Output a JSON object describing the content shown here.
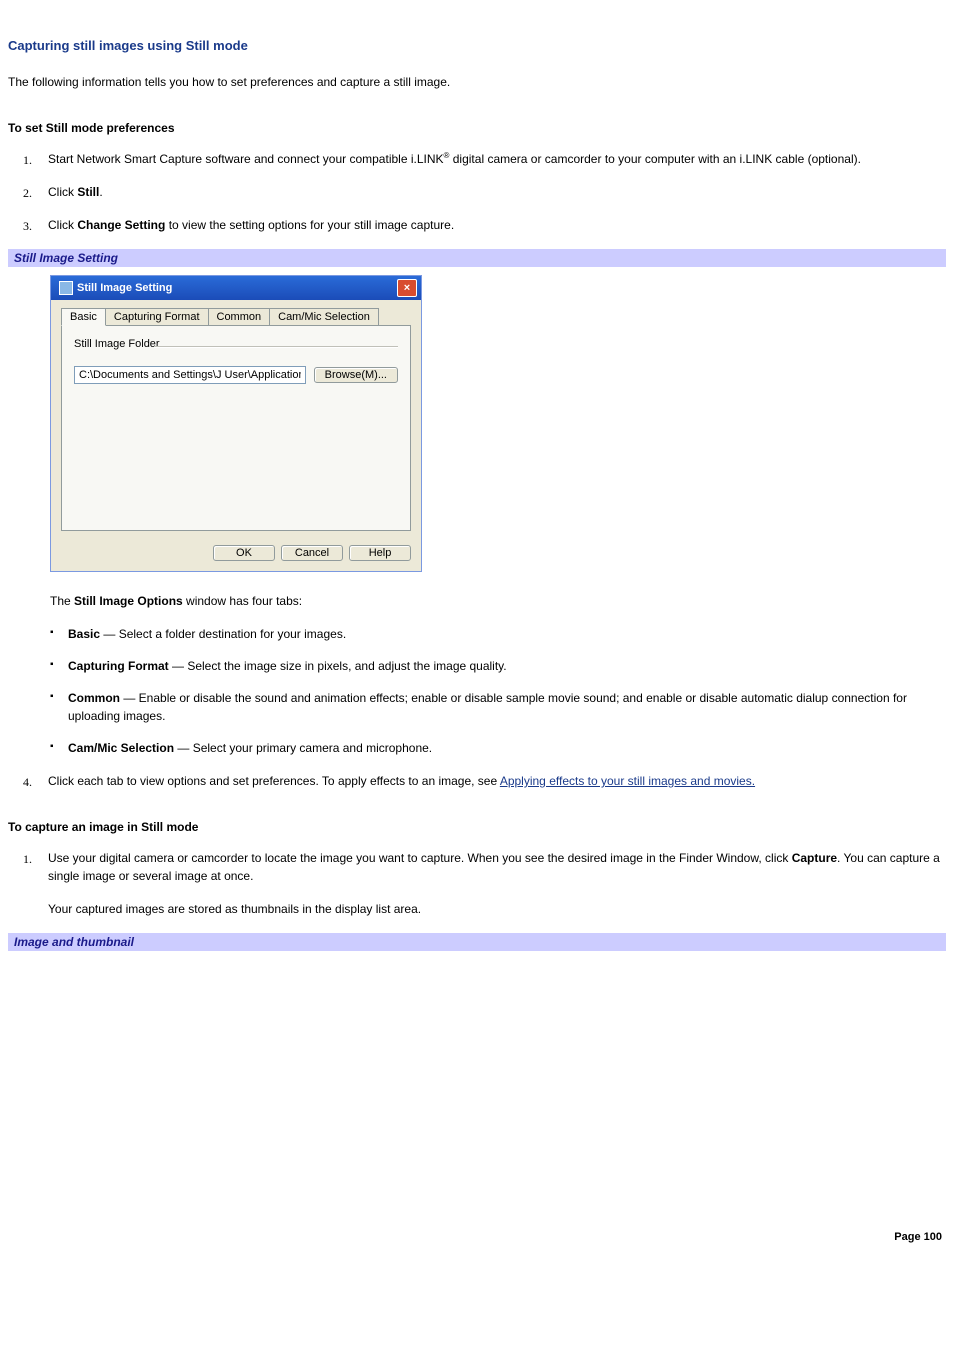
{
  "page_title": "Capturing still images using Still mode",
  "intro": "The following information tells you how to set preferences and capture a still image.",
  "section_a_heading": "To set Still mode preferences",
  "steps_a": {
    "num1": "1.",
    "s1_pre": "Start Network Smart Capture software and connect your compatible i.LINK",
    "s1_sup": "®",
    "s1_post": " digital camera or camcorder to your computer with an i.LINK cable (optional).",
    "num2": "2.",
    "s2_pre": "Click ",
    "s2_bold": "Still",
    "s2_post": ".",
    "num3": "3.",
    "s3_pre": "Click ",
    "s3_bold": "Change Setting",
    "s3_post": " to view the setting options for your still image capture."
  },
  "image_caption_1": "Still Image Setting",
  "dialog": {
    "title": "Still Image Setting",
    "tabs": {
      "basic": "Basic",
      "capturing_format": "Capturing Format",
      "common": "Common",
      "cam_mic": "Cam/Mic Selection"
    },
    "fieldset_label": "Still Image Folder",
    "path_value": "C:\\Documents and Settings\\J User\\Application Data\\So",
    "browse_label": "Browse(M)...",
    "ok": "OK",
    "cancel": "Cancel",
    "help": "Help"
  },
  "sub_intro_pre": "The ",
  "sub_intro_bold": "Still Image Options",
  "sub_intro_post": " window has four tabs:",
  "bullets": {
    "b1_bold": "Basic",
    "b1_rest": " — Select a folder destination for your images.",
    "b2_bold": "Capturing Format",
    "b2_rest": " — Select the image size in pixels, and adjust the image quality.",
    "b3_bold": "Common",
    "b3_rest": " — Enable or disable the sound and animation effects; enable or disable sample movie sound; and enable or disable automatic dialup connection for uploading images.",
    "b4_bold": "Cam/Mic Selection",
    "b4_rest": " — Select your primary camera and microphone."
  },
  "step4": {
    "num": "4.",
    "pre": "Click each tab to view options and set preferences. To apply effects to an image, see ",
    "link": "Applying effects to your still images and movies."
  },
  "section_b_heading": "To capture an image in Still mode",
  "steps_b": {
    "num1": "1.",
    "s1_pre": "Use your digital camera or camcorder to locate the image you want to capture. When you see the desired image in the Finder Window, click ",
    "s1_bold": "Capture",
    "s1_post": ". You can capture a single image or several image at once.",
    "s1_para2": "Your captured images are stored as thumbnails in the display list area."
  },
  "image_caption_2": "Image and thumbnail",
  "page_footer": "Page 100"
}
